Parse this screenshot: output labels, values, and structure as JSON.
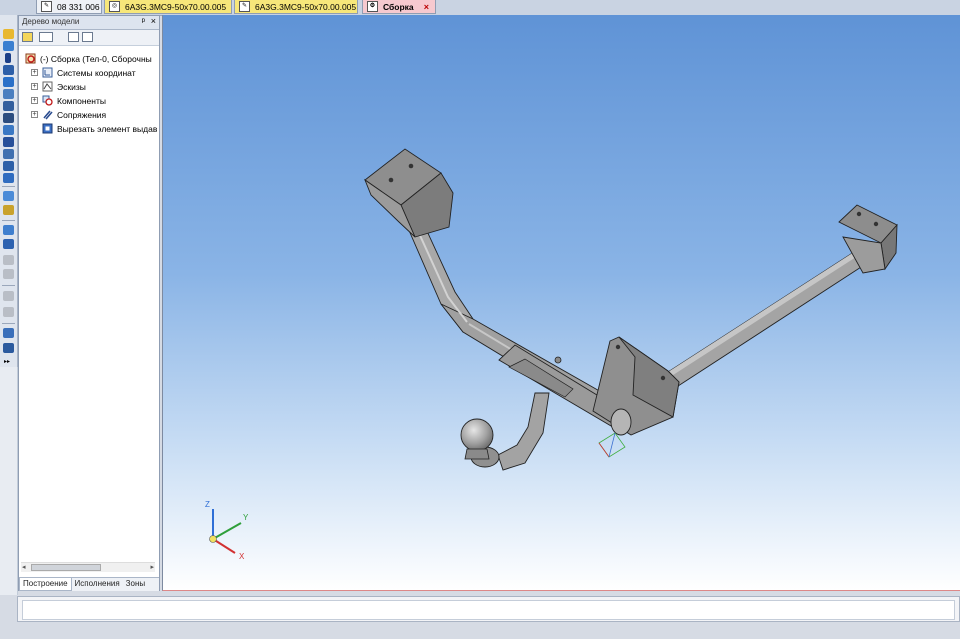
{
  "tabs": [
    {
      "label": "08 331 006",
      "icon": "assembly-doc-icon",
      "state": "normal"
    },
    {
      "label": "6A3G.3MC9-50x70.00.005",
      "icon": "part-doc-icon",
      "state": "yellow"
    },
    {
      "label": "6A3G.3MC9-50x70.00.005",
      "icon": "assembly-doc-icon",
      "state": "yellow"
    },
    {
      "label": "Сборка",
      "icon": "assembly-doc-icon",
      "state": "active",
      "close": "×"
    }
  ],
  "panel": {
    "title": "Дерево модели",
    "pin": "ᵖ",
    "close": "×"
  },
  "tree": {
    "root": "(-) Сборка (Тел-0, Сборочны",
    "items": [
      {
        "label": "Системы координат",
        "icon": "coordinate-systems-icon",
        "expander": "+"
      },
      {
        "label": "Эскизы",
        "icon": "sketches-icon",
        "expander": "+"
      },
      {
        "label": "Компоненты",
        "icon": "components-icon",
        "expander": "+"
      },
      {
        "label": "Сопряжения",
        "icon": "mates-icon",
        "expander": "+"
      },
      {
        "label": "Вырезать элемент выдав",
        "icon": "cut-extrude-icon",
        "expander": ""
      }
    ]
  },
  "bottom_tabs": [
    "Построение",
    "Исполнения",
    "Зоны"
  ],
  "scroll": {
    "left": "◂",
    "right": "▸"
  },
  "axes": {
    "x": "X",
    "y": "Y",
    "z": "Z"
  },
  "colors": {
    "tab_active": "#f6c9cf",
    "tab_yellow": "#f7e77a",
    "viewport_top": "#5f93d6",
    "viewport_bottom": "#ffffff",
    "model_gray": "#9a9a9a"
  }
}
